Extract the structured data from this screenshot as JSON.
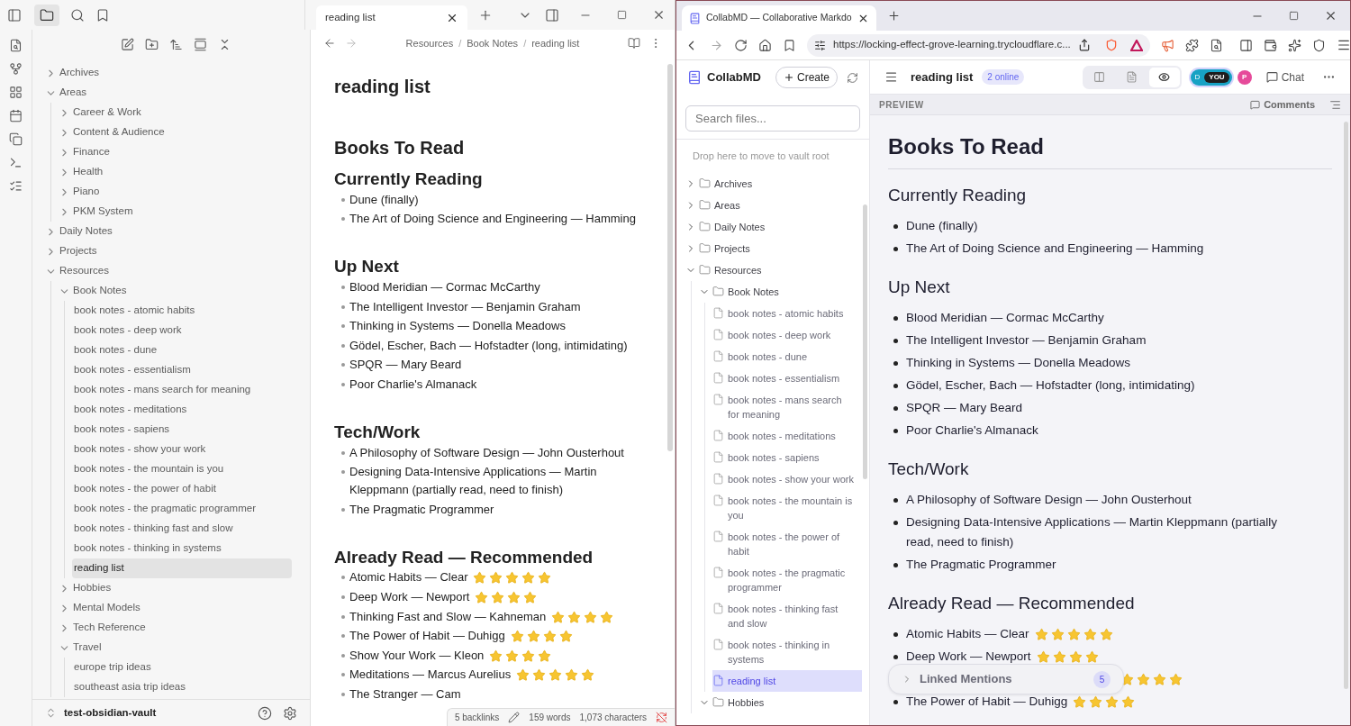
{
  "obsidian": {
    "tree": [
      {
        "kind": "folder",
        "name": "Archives",
        "expanded": false,
        "selected": false
      },
      {
        "kind": "folder",
        "name": "Areas",
        "expanded": true,
        "selected": false,
        "children": [
          {
            "kind": "folder",
            "name": "Career & Work",
            "expanded": false,
            "selected": false
          },
          {
            "kind": "folder",
            "name": "Content & Audience",
            "expanded": false,
            "selected": false
          },
          {
            "kind": "folder",
            "name": "Finance",
            "expanded": false,
            "selected": false
          },
          {
            "kind": "folder",
            "name": "Health",
            "expanded": false,
            "selected": false
          },
          {
            "kind": "folder",
            "name": "Piano",
            "expanded": false,
            "selected": false
          },
          {
            "kind": "folder",
            "name": "PKM System",
            "expanded": false,
            "selected": false
          }
        ]
      },
      {
        "kind": "folder",
        "name": "Daily Notes",
        "expanded": false,
        "selected": false
      },
      {
        "kind": "folder",
        "name": "Projects",
        "expanded": false,
        "selected": false
      },
      {
        "kind": "folder",
        "name": "Resources",
        "expanded": true,
        "selected": false,
        "children": [
          {
            "kind": "folder",
            "name": "Book Notes",
            "expanded": true,
            "selected": false,
            "children": [
              {
                "kind": "file",
                "name": "book notes - atomic habits",
                "selected": false
              },
              {
                "kind": "file",
                "name": "book notes - deep work",
                "selected": false
              },
              {
                "kind": "file",
                "name": "book notes - dune",
                "selected": false
              },
              {
                "kind": "file",
                "name": "book notes - essentialism",
                "selected": false
              },
              {
                "kind": "file",
                "name": "book notes - mans search for meaning",
                "selected": false
              },
              {
                "kind": "file",
                "name": "book notes - meditations",
                "selected": false
              },
              {
                "kind": "file",
                "name": "book notes - sapiens",
                "selected": false
              },
              {
                "kind": "file",
                "name": "book notes - show your work",
                "selected": false
              },
              {
                "kind": "file",
                "name": "book notes - the mountain is you",
                "selected": false
              },
              {
                "kind": "file",
                "name": "book notes - the power of habit",
                "selected": false
              },
              {
                "kind": "file",
                "name": "book notes - the pragmatic programmer",
                "selected": false
              },
              {
                "kind": "file",
                "name": "book notes - thinking fast and slow",
                "selected": false
              },
              {
                "kind": "file",
                "name": "book notes - thinking in systems",
                "selected": false
              },
              {
                "kind": "file",
                "name": "reading list",
                "selected": true
              }
            ]
          },
          {
            "kind": "folder",
            "name": "Hobbies",
            "expanded": false,
            "selected": false
          },
          {
            "kind": "folder",
            "name": "Mental Models",
            "expanded": false,
            "selected": false
          },
          {
            "kind": "folder",
            "name": "Tech Reference",
            "expanded": false,
            "selected": false
          },
          {
            "kind": "folder",
            "name": "Travel",
            "expanded": true,
            "selected": false,
            "children": [
              {
                "kind": "file",
                "name": "europe trip ideas",
                "selected": false
              },
              {
                "kind": "file",
                "name": "southeast asia trip ideas",
                "selected": false
              }
            ]
          }
        ]
      }
    ],
    "vault_name": "test-obsidian-vault",
    "tab_title": "reading list",
    "breadcrumbs": [
      "Resources",
      "Book Notes",
      "reading list"
    ],
    "breadcrumb_separator": "/",
    "note": {
      "title": "reading list",
      "h1": "Books To Read",
      "sections": [
        {
          "heading": "Currently Reading",
          "items": [
            {
              "text": "Dune (finally)"
            },
            {
              "text": "The Art of Doing Science and Engineering — Hamming"
            }
          ]
        },
        {
          "heading": "Up Next",
          "items": [
            {
              "text": "Blood Meridian — Cormac McCarthy"
            },
            {
              "text": "The Intelligent Investor — Benjamin Graham"
            },
            {
              "text": "Thinking in Systems — Donella Meadows"
            },
            {
              "text": "Gödel, Escher, Bach — Hofstadter (long, intimidating)"
            },
            {
              "text": "SPQR — Mary Beard"
            },
            {
              "text": "Poor Charlie's Almanack"
            }
          ]
        },
        {
          "heading": "Tech/Work",
          "items": [
            {
              "text": "A Philosophy of Software Design — John Ousterhout"
            },
            {
              "text": "Designing Data-Intensive Applications — Martin Kleppmann (partially read, need to finish)"
            },
            {
              "text": "The Pragmatic Programmer"
            }
          ]
        },
        {
          "heading": "Already Read — Recommended",
          "items": [
            {
              "text": "Atomic Habits — Clear",
              "stars": 5
            },
            {
              "text": "Deep Work — Newport",
              "stars": 4
            },
            {
              "text": "Thinking Fast and Slow — Kahneman",
              "stars": 4
            },
            {
              "text": "The Power of Habit — Duhigg",
              "stars": 4
            },
            {
              "text": "Show Your Work — Kleon",
              "stars": 4
            },
            {
              "text": "Meditations — Marcus Aurelius",
              "stars": 5
            },
            {
              "text": "The Stranger — Cam"
            }
          ]
        }
      ]
    },
    "status": {
      "backlinks": "5 backlinks",
      "words": "159 words",
      "characters": "1,073 characters"
    }
  },
  "browser": {
    "tab_title": "CollabMD — Collaborative Markdo",
    "url": "https://locking-effect-grove-learning.trycloudflare.c...",
    "app": {
      "name": "CollabMD",
      "create_label": "Create",
      "search_placeholder": "Search files...",
      "drop_hint": "Drop here to move to vault root",
      "tree": [
        {
          "kind": "folder",
          "name": "Archives",
          "expanded": false,
          "selected": false
        },
        {
          "kind": "folder",
          "name": "Areas",
          "expanded": false,
          "selected": false
        },
        {
          "kind": "folder",
          "name": "Daily Notes",
          "expanded": false,
          "selected": false
        },
        {
          "kind": "folder",
          "name": "Projects",
          "expanded": false,
          "selected": false
        },
        {
          "kind": "folder",
          "name": "Resources",
          "expanded": true,
          "selected": false,
          "children": [
            {
              "kind": "folder",
              "name": "Book Notes",
              "expanded": true,
              "selected": false,
              "children": [
                {
                  "kind": "file",
                  "name": "book notes - atomic habits",
                  "selected": false
                },
                {
                  "kind": "file",
                  "name": "book notes - deep work",
                  "selected": false
                },
                {
                  "kind": "file",
                  "name": "book notes - dune",
                  "selected": false
                },
                {
                  "kind": "file",
                  "name": "book notes - essentialism",
                  "selected": false
                },
                {
                  "kind": "file",
                  "name": "book notes - mans search for meaning",
                  "selected": false
                },
                {
                  "kind": "file",
                  "name": "book notes - meditations",
                  "selected": false
                },
                {
                  "kind": "file",
                  "name": "book notes - sapiens",
                  "selected": false
                },
                {
                  "kind": "file",
                  "name": "book notes - show your work",
                  "selected": false
                },
                {
                  "kind": "file",
                  "name": "book notes - the mountain is you",
                  "selected": false
                },
                {
                  "kind": "file",
                  "name": "book notes - the power of habit",
                  "selected": false
                },
                {
                  "kind": "file",
                  "name": "book notes - the pragmatic programmer",
                  "selected": false
                },
                {
                  "kind": "file",
                  "name": "book notes - thinking fast and slow",
                  "selected": false
                },
                {
                  "kind": "file",
                  "name": "book notes - thinking in systems",
                  "selected": false
                },
                {
                  "kind": "file",
                  "name": "reading list",
                  "selected": true
                }
              ]
            },
            {
              "kind": "folder",
              "name": "Hobbies",
              "expanded": true,
              "selected": false
            }
          ]
        }
      ],
      "doc_title": "reading list",
      "online_badge": "2 online",
      "view_modes": [
        {
          "kind": "split",
          "selected": false
        },
        {
          "kind": "source",
          "selected": false
        },
        {
          "kind": "preview",
          "selected": true
        }
      ],
      "users": [
        {
          "letter": "D",
          "label": "YOU",
          "color": "#17a2c4"
        },
        {
          "letter": "P",
          "color": "#e64a9a"
        }
      ],
      "chat_label": "Chat",
      "preview_label": "PREVIEW",
      "comments_label": "Comments",
      "doc": {
        "h1": "Books To Read",
        "sections": [
          {
            "heading": "Currently Reading",
            "items": [
              {
                "text": "Dune (finally)"
              },
              {
                "text": "The Art of Doing Science and Engineering — Hamming"
              }
            ]
          },
          {
            "heading": "Up Next",
            "items": [
              {
                "text": "Blood Meridian — Cormac McCarthy"
              },
              {
                "text": "The Intelligent Investor — Benjamin Graham"
              },
              {
                "text": "Thinking in Systems — Donella Meadows"
              },
              {
                "text": "Gödel, Escher, Bach — Hofstadter (long, intimidating)"
              },
              {
                "text": "SPQR — Mary Beard"
              },
              {
                "text": "Poor Charlie's Almanack"
              }
            ]
          },
          {
            "heading": "Tech/Work",
            "items": [
              {
                "text": "A Philosophy of Software Design — John Ousterhout"
              },
              {
                "text": "Designing Data-Intensive Applications — Martin Kleppmann (partially read, need to finish)"
              },
              {
                "text": "The Pragmatic Programmer"
              }
            ]
          },
          {
            "heading": "Already Read — Recommended",
            "items": [
              {
                "text": "Atomic Habits — Clear",
                "stars": 5
              },
              {
                "text": "Deep Work — Newport",
                "stars": 4
              },
              {
                "stars": 4
              },
              {
                "text": "The Power of Habit — Duhigg",
                "stars": 4
              }
            ]
          }
        ]
      },
      "linked_mentions": {
        "label": "Linked Mentions",
        "count": "5",
        "expanded": false
      }
    }
  }
}
